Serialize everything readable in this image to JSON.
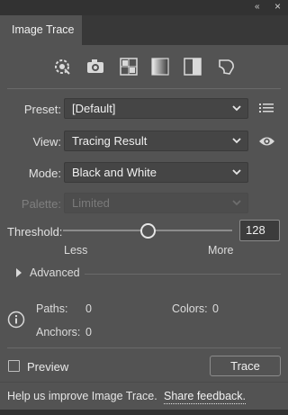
{
  "window": {
    "collapse_glyph": "«",
    "menu_glyph": "≡",
    "tab_label": "Image Trace"
  },
  "presets_toolbar": {
    "icons": [
      "auto-color-icon",
      "high-color-icon",
      "low-color-icon",
      "grayscale-icon",
      "black-and-white-icon",
      "outline-icon"
    ]
  },
  "preset": {
    "label": "Preset:",
    "value": "[Default]",
    "manage_icon": "list-icon"
  },
  "view": {
    "label": "View:",
    "value": "Tracing Result",
    "toggle_icon": "eye-icon"
  },
  "mode": {
    "label": "Mode:",
    "value": "Black and White"
  },
  "palette": {
    "label": "Palette:",
    "value": "Limited",
    "disabled": true
  },
  "threshold": {
    "label": "Threshold:",
    "value": "128",
    "min_label": "Less",
    "max_label": "More",
    "fraction": 0.5
  },
  "advanced": {
    "label": "Advanced"
  },
  "stats": {
    "paths_label": "Paths:",
    "paths_value": "0",
    "colors_label": "Colors:",
    "colors_value": "0",
    "anchors_label": "Anchors:",
    "anchors_value": "0"
  },
  "actions": {
    "preview_label": "Preview",
    "preview_checked": false,
    "trace_label": "Trace"
  },
  "footer": {
    "text": "Help us improve Image Trace.",
    "link": "Share feedback."
  }
}
